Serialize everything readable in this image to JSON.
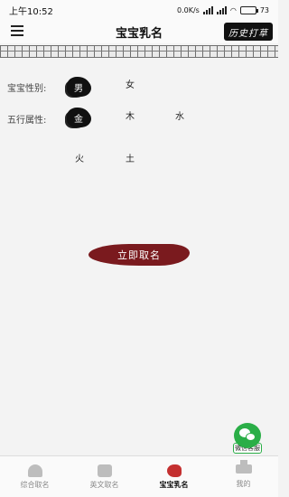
{
  "status_bar": {
    "time": "上午10:52",
    "network": "0.0K/s",
    "battery": "73"
  },
  "header": {
    "title": "宝宝乳名",
    "seal_text": "历史打草"
  },
  "form": {
    "gender_label": "宝宝性别:",
    "gender_options": [
      "男",
      "女"
    ],
    "gender_selected": "男",
    "element_label": "五行属性:",
    "element_options": [
      "金",
      "木",
      "水",
      "火",
      "土"
    ],
    "element_selected": "金",
    "submit_label": "立即取名"
  },
  "wechat": {
    "label": "微信客服"
  },
  "tabbar": {
    "tabs": [
      {
        "label": "综合取名",
        "icon": "helmet-icon"
      },
      {
        "label": "英文取名",
        "icon": "book-icon"
      },
      {
        "label": "宝宝乳名",
        "icon": "rocking-horse-icon"
      },
      {
        "label": "我的",
        "icon": "graduation-cap-icon"
      }
    ],
    "active": "宝宝乳名"
  },
  "colors": {
    "accent": "#7a1a1e",
    "ink": "#111111",
    "wechat": "#2aae47",
    "active_icon": "#c43030"
  }
}
